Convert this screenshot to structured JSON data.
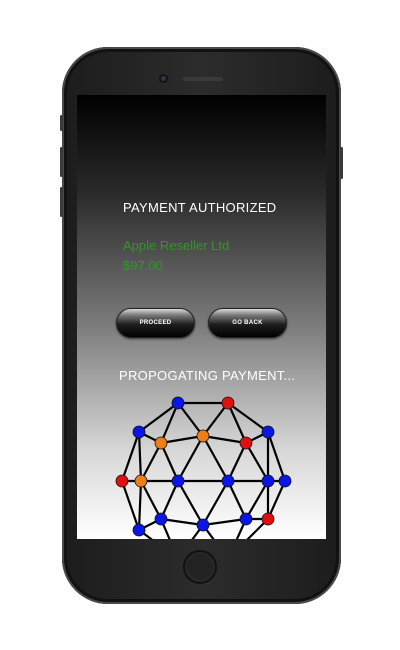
{
  "screen": {
    "title": "PAYMENT AUTHORIZED",
    "merchant": "Apple Reseller Ltd",
    "amount": "$97.00",
    "buttons": {
      "proceed": "PROCEED",
      "go_back": "GO BACK"
    },
    "status": "PROPOGATING PAYMENT..."
  },
  "colors": {
    "merchant_text": "#2e9a24",
    "node_blue": "#0a16e6",
    "node_orange": "#f07d1a",
    "node_red": "#e01010"
  },
  "network": {
    "nodes": [
      {
        "id": "n1",
        "color": "blue"
      },
      {
        "id": "n2",
        "color": "red"
      },
      {
        "id": "n3",
        "color": "blue"
      },
      {
        "id": "n4",
        "color": "orange"
      },
      {
        "id": "n5",
        "color": "orange"
      },
      {
        "id": "n6",
        "color": "red"
      },
      {
        "id": "n7",
        "color": "blue"
      },
      {
        "id": "n8",
        "color": "red"
      },
      {
        "id": "n9",
        "color": "orange"
      },
      {
        "id": "n10",
        "color": "blue"
      },
      {
        "id": "n11",
        "color": "blue"
      },
      {
        "id": "n12",
        "color": "blue"
      },
      {
        "id": "n13",
        "color": "blue"
      },
      {
        "id": "n14",
        "color": "blue"
      },
      {
        "id": "n15",
        "color": "blue"
      },
      {
        "id": "n16",
        "color": "blue"
      },
      {
        "id": "n17",
        "color": "red"
      },
      {
        "id": "n18",
        "color": "blue"
      },
      {
        "id": "n19",
        "color": "blue"
      },
      {
        "id": "n20",
        "color": "blue"
      }
    ]
  }
}
